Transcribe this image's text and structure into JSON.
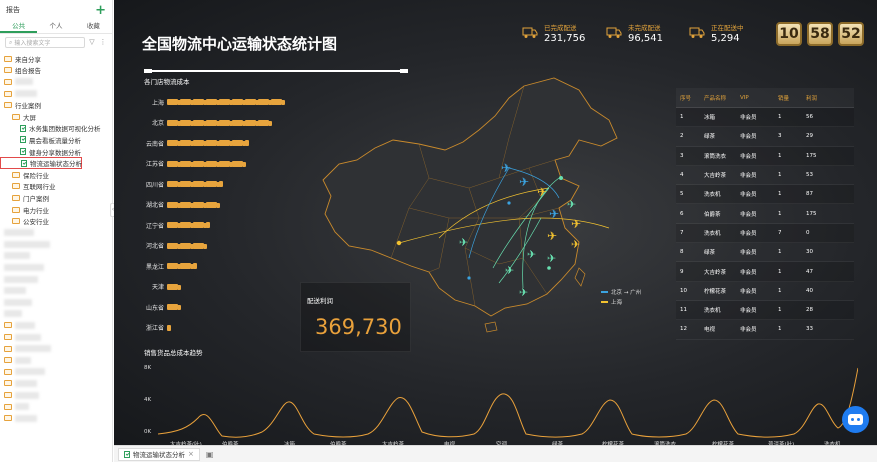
{
  "sidebar": {
    "title": "报告",
    "tabs": [
      "公共",
      "个人",
      "收藏"
    ],
    "search_placeholder": "输入搜索文字",
    "tree": [
      {
        "label": "来自分享",
        "type": "folder",
        "level": 0
      },
      {
        "label": "组合报告",
        "type": "folder",
        "level": 0
      },
      {
        "label": "",
        "type": "folder",
        "level": 0,
        "blur": 18
      },
      {
        "label": "",
        "type": "folder",
        "level": 0,
        "blur": 22
      },
      {
        "label": "行业案例",
        "type": "folder",
        "level": 0
      },
      {
        "label": "大屏",
        "type": "folder",
        "level": 1
      },
      {
        "label": "水务集团数据可视化分析",
        "type": "file",
        "level": 2
      },
      {
        "label": "晨会看板流量分析",
        "type": "file",
        "level": 2
      },
      {
        "label": "健身分享数据分析",
        "type": "file",
        "level": 2
      },
      {
        "label": "物流运输状态分析",
        "type": "file",
        "level": 2,
        "selected": true
      },
      {
        "label": "保险行业",
        "type": "folder",
        "level": 1
      },
      {
        "label": "互联网行业",
        "type": "folder",
        "level": 1
      },
      {
        "label": "门户案例",
        "type": "folder",
        "level": 1
      },
      {
        "label": "电力行业",
        "type": "folder",
        "level": 1
      },
      {
        "label": "公安行业",
        "type": "folder",
        "level": 1
      },
      {
        "label": "",
        "type": "blur",
        "level": 0,
        "blur": 30
      },
      {
        "label": "",
        "type": "blur",
        "level": 0,
        "blur": 46
      },
      {
        "label": "",
        "type": "blur",
        "level": 0,
        "blur": 26
      },
      {
        "label": "",
        "type": "blur",
        "level": 0,
        "blur": 40
      },
      {
        "label": "",
        "type": "blur",
        "level": 0,
        "blur": 34
      },
      {
        "label": "",
        "type": "blur",
        "level": 0,
        "blur": 22
      },
      {
        "label": "",
        "type": "blur",
        "level": 0,
        "blur": 28
      },
      {
        "label": "",
        "type": "blur",
        "level": 0,
        "blur": 18
      },
      {
        "label": "",
        "type": "folder",
        "level": 0,
        "blur": 20
      },
      {
        "label": "",
        "type": "folder",
        "level": 0,
        "blur": 26
      },
      {
        "label": "",
        "type": "folder",
        "level": 0,
        "blur": 36
      },
      {
        "label": "",
        "type": "folder",
        "level": 0,
        "blur": 16
      },
      {
        "label": "",
        "type": "folder",
        "level": 0,
        "blur": 30
      },
      {
        "label": "",
        "type": "folder",
        "level": 0,
        "blur": 22
      },
      {
        "label": "",
        "type": "folder",
        "level": 0,
        "blur": 24
      },
      {
        "label": "",
        "type": "folder",
        "level": 0,
        "blur": 14
      },
      {
        "label": "",
        "type": "folder",
        "level": 0,
        "blur": 22
      }
    ]
  },
  "dashboard": {
    "title": "全国物流中心运输状态统计图",
    "stats": [
      {
        "label": "已完成配送",
        "value": "231,756"
      },
      {
        "label": "未完成配送",
        "value": "96,541"
      },
      {
        "label": "正在配送中",
        "value": "5,294"
      }
    ],
    "clock": [
      "10",
      "58",
      "52"
    ],
    "cost_title": "各门店物流成本",
    "cost_rows": [
      {
        "city": "上海",
        "trucks": 9
      },
      {
        "city": "北京",
        "trucks": 8
      },
      {
        "city": "云南省",
        "trucks": 6.5
      },
      {
        "city": "江苏省",
        "trucks": 6
      },
      {
        "city": "四川省",
        "trucks": 4.5
      },
      {
        "city": "湖北省",
        "trucks": 4
      },
      {
        "city": "辽宁省",
        "trucks": 3.5
      },
      {
        "city": "河北省",
        "trucks": 3
      },
      {
        "city": "黑龙江",
        "trucks": 2.5
      },
      {
        "city": "天津",
        "trucks": 1
      },
      {
        "city": "山东省",
        "trucks": 1
      },
      {
        "city": "浙江省",
        "trucks": 0.5
      }
    ],
    "legend": [
      "北京 → 广州",
      "上海"
    ],
    "colors": {
      "accent": "#e9a13b",
      "route_a": "#3ba3e0",
      "route_b": "#f2c230",
      "route_c": "#68e0b0"
    },
    "kpi": {
      "label": "配送利润",
      "value": "369,730"
    },
    "table": {
      "headers": [
        "序号",
        "产品名称",
        "VIP",
        "销量",
        "利润"
      ],
      "rows": [
        [
          "1",
          "冰箱",
          "非会员",
          "1",
          "56"
        ],
        [
          "2",
          "绿茶",
          "非会员",
          "3",
          "29"
        ],
        [
          "3",
          "滚筒洗衣",
          "非会员",
          "1",
          "175"
        ],
        [
          "4",
          "大吉岭茶",
          "非会员",
          "1",
          "53"
        ],
        [
          "5",
          "洗衣机",
          "非会员",
          "1",
          "87"
        ],
        [
          "6",
          "伯爵茶",
          "非会员",
          "1",
          "175"
        ],
        [
          "7",
          "洗衣机",
          "非会员",
          "7",
          "0"
        ],
        [
          "8",
          "绿茶",
          "非会员",
          "1",
          "30"
        ],
        [
          "9",
          "大吉岭茶",
          "非会员",
          "1",
          "47"
        ],
        [
          "10",
          "柠檬花茶",
          "非会员",
          "1",
          "40"
        ],
        [
          "11",
          "洗衣机",
          "非会员",
          "1",
          "28"
        ],
        [
          "12",
          "电视",
          "非会员",
          "1",
          "33"
        ]
      ]
    },
    "trend_title": "销售货品总成本趋势",
    "trend_yticks": [
      "8K",
      "4K",
      "0K"
    ],
    "trend_xlabels": [
      "大吉岭茶(叶)",
      "伯爵茶",
      "冰箱",
      "伯爵茶",
      "大吉岭茶",
      "电视",
      "空调",
      "绿茶",
      "柠檬花茶",
      "滚筒洗衣",
      "柠檬花茶",
      "普洱茶(叶)",
      "洗衣机"
    ]
  },
  "bottom_tab": {
    "label": "物流运输状态分析"
  }
}
